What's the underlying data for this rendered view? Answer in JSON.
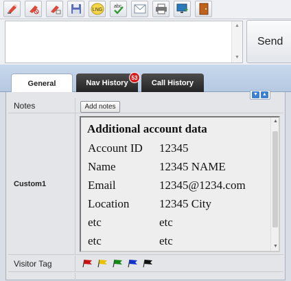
{
  "toolbar": {
    "buttons": [
      {
        "name": "highlighter-icon",
        "color": "#d94a3a"
      },
      {
        "name": "highlighter-cancel-icon",
        "color": "#d94a3a"
      },
      {
        "name": "highlighter-clear-icon",
        "color": "#d94a3a"
      },
      {
        "name": "save-icon",
        "color": "#5b6fb8"
      },
      {
        "name": "language-icon",
        "label": "LNG",
        "color": "#e8c531"
      },
      {
        "name": "spellcheck-icon",
        "label": "abc",
        "color": "#3a9a3a"
      },
      {
        "name": "email-icon",
        "color": "#7a8aa0"
      },
      {
        "name": "print-icon",
        "color": "#555"
      },
      {
        "name": "monitor-download-icon",
        "color": "#2a7ab8"
      },
      {
        "name": "exit-door-icon",
        "color": "#c0621a"
      }
    ]
  },
  "compose": {
    "message_value": "",
    "send_label": "Send"
  },
  "tabs": {
    "general": "General",
    "nav_history": "Nav History",
    "nav_history_badge": "53",
    "call_history": "Call History"
  },
  "details": {
    "notes_label": "Notes",
    "add_notes_label": "Add notes",
    "custom_label": "Custom1",
    "custom": {
      "title": "Additional account data",
      "rows": [
        {
          "key": "Account ID",
          "value": "12345"
        },
        {
          "key": "Name",
          "value": "12345 NAME"
        },
        {
          "key": "Email",
          "value": "12345@1234.com"
        },
        {
          "key": "Location",
          "value": "12345 City"
        },
        {
          "key": "etc",
          "value": "etc"
        },
        {
          "key": "etc",
          "value": "etc"
        }
      ]
    },
    "visitor_tag_label": "Visitor Tag",
    "flags": [
      {
        "name": "red-flag-icon",
        "color": "#cc1111"
      },
      {
        "name": "yellow-flag-icon",
        "color": "#e6c200"
      },
      {
        "name": "green-flag-icon",
        "color": "#118811"
      },
      {
        "name": "blue-flag-icon",
        "color": "#1133cc"
      },
      {
        "name": "black-flag-icon",
        "color": "#111111"
      }
    ]
  },
  "colors": {
    "tab_strip": "#b5c9e2",
    "badge": "#d42020",
    "dark_tab": "#242424"
  }
}
